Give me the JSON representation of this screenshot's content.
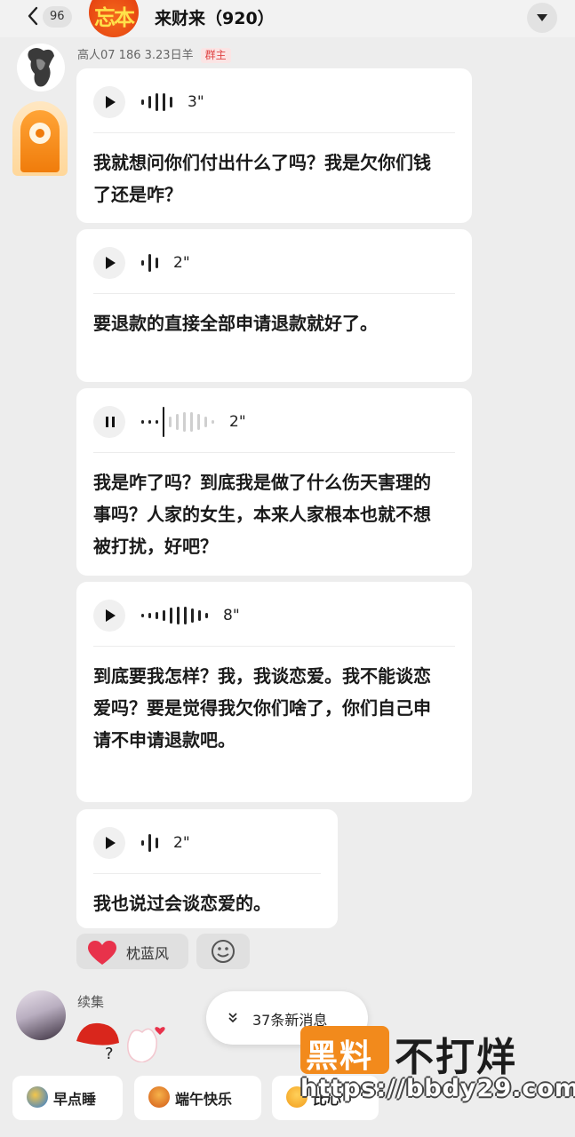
{
  "header": {
    "back_count": "96",
    "group_avatar_text": "忘本",
    "title": "来财来（920）"
  },
  "sender": {
    "info": "高人07  186  3.23日羊",
    "role_badge": "群主"
  },
  "messages": [
    {
      "duration": "3\"",
      "state": "paused",
      "transcript": "我就想问你们付出什么了吗？我是欠你们钱了还是咋？"
    },
    {
      "duration": "2\"",
      "state": "paused",
      "transcript": "要退款的直接全部申请退款就好了。"
    },
    {
      "duration": "2\"",
      "state": "playing",
      "transcript": "我是咋了吗？到底我是做了什么伤天害理的事吗？人家的女生，本来人家根本也就不想被打扰，好吧？"
    },
    {
      "duration": "8\"",
      "state": "paused",
      "transcript": "到底要我怎样？我，我谈恋爱。我不能谈恋爱吗？要是觉得我欠你们啥了，你们自己申请不申请退款吧。"
    },
    {
      "duration": "2\"",
      "state": "paused",
      "transcript": "我也说过会谈恋爱的。"
    }
  ],
  "reaction": {
    "icon": "heart-icon",
    "user": "枕蓝风"
  },
  "sender2": {
    "name": "续集"
  },
  "new_messages": {
    "label": "37条新消息"
  },
  "quick_replies": [
    "早点睡",
    "端午快乐",
    "比心"
  ],
  "watermark": {
    "badge": "黑料",
    "text": "不打烊",
    "url": "https://bbdy29.com"
  },
  "colors": {
    "background": "#ededed",
    "bubble": "#ffffff",
    "owner_badge": "#e04545",
    "watermark_orange": "#f28a1c"
  }
}
